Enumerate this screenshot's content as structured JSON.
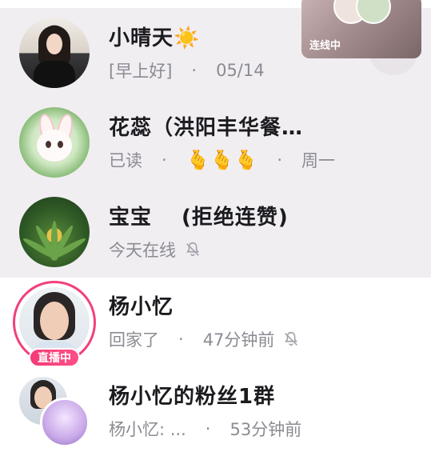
{
  "chats": [
    {
      "name": "小晴天☀️",
      "status": "[早上好]",
      "time": "05/14",
      "muted": false
    },
    {
      "name": "花蕊（洪阳丰华餐…",
      "status": "已读",
      "message_emoji": "🫰🫰🫰",
      "time": "周一",
      "muted": false
    },
    {
      "name": "宝宝　 (拒绝连赞)",
      "status": "今天在线",
      "muted": true
    },
    {
      "name": "杨小忆",
      "status": "回家了",
      "time": "47分钟前",
      "muted": true,
      "live_badge": "直播中"
    },
    {
      "name": "杨小忆的粉丝1群",
      "status": "杨小忆: ...",
      "time": "53分钟前",
      "muted": false
    }
  ],
  "overlay": {
    "label": "连线中"
  },
  "colors": {
    "accent": "#f2407a",
    "name_text": "#1b1b1f",
    "sub_text": "#8b8b93",
    "pinned_bg": "#f1eef2"
  }
}
